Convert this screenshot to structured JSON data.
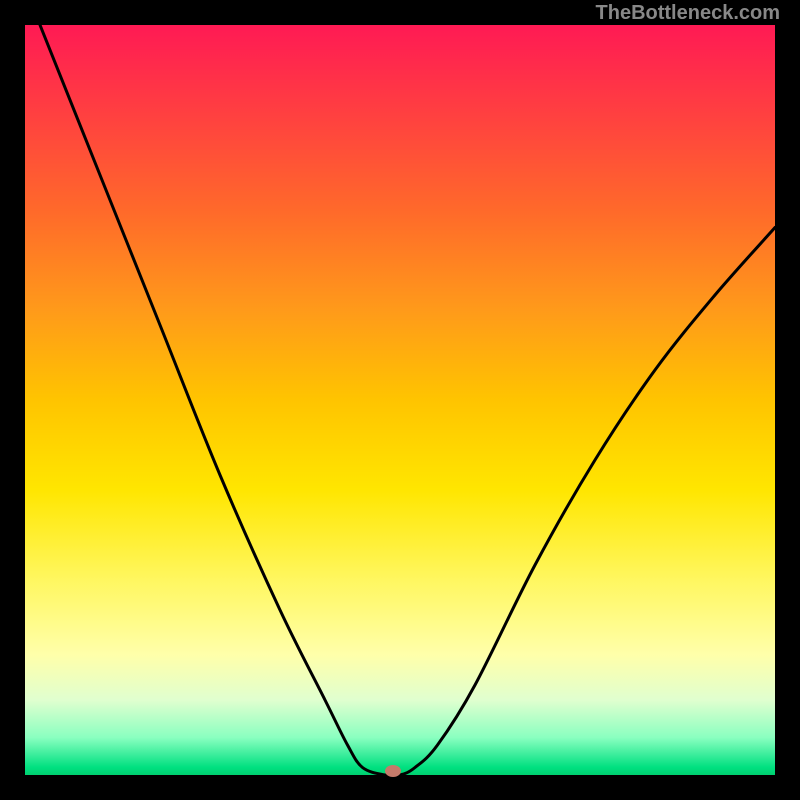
{
  "watermark": "TheBottleneck.com",
  "chart_data": {
    "type": "line",
    "title": "",
    "xlabel": "",
    "ylabel": "",
    "xlim": [
      0,
      1
    ],
    "ylim": [
      0,
      1
    ],
    "series": [
      {
        "name": "curve",
        "x": [
          0.02,
          0.1,
          0.18,
          0.26,
          0.34,
          0.4,
          0.43,
          0.45,
          0.48,
          0.5,
          0.52,
          0.55,
          0.6,
          0.68,
          0.76,
          0.84,
          0.92,
          1.0
        ],
        "y": [
          1.0,
          0.8,
          0.6,
          0.4,
          0.22,
          0.1,
          0.04,
          0.01,
          0.0,
          0.0,
          0.01,
          0.04,
          0.12,
          0.28,
          0.42,
          0.54,
          0.64,
          0.73
        ]
      }
    ],
    "marker": {
      "x": 0.49,
      "y": 0.005,
      "color": "#c47a6a"
    },
    "gradient_stops": [
      {
        "pos": 0.0,
        "color": "#ff1a54"
      },
      {
        "pos": 0.5,
        "color": "#ffe600"
      },
      {
        "pos": 1.0,
        "color": "#00d070"
      }
    ]
  }
}
